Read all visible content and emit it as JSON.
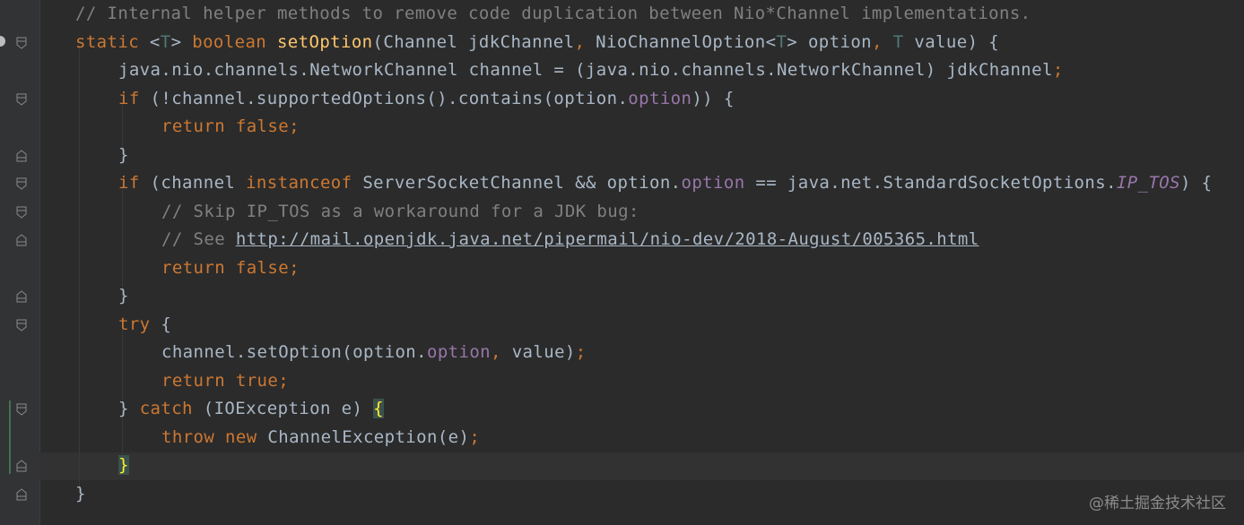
{
  "editor": {
    "colors": {
      "background": "#2b2b2b",
      "gutter": "#313335",
      "comment": "#808080",
      "keyword": "#cc7832",
      "method": "#ffc66d",
      "field": "#9876aa",
      "type_param": "#507874",
      "text": "#a9b7c6"
    },
    "lines": [
      {
        "tokens": [
          {
            "t": "// Internal helper methods to remove code duplication between Nio*Channel implementations.",
            "c": "comment"
          }
        ]
      },
      {
        "tokens": [
          {
            "t": "static ",
            "c": "kw"
          },
          {
            "t": "<",
            "c": "plain"
          },
          {
            "t": "T",
            "c": "type"
          },
          {
            "t": "> ",
            "c": "plain"
          },
          {
            "t": "boolean ",
            "c": "kw"
          },
          {
            "t": "setOption",
            "c": "fn"
          },
          {
            "t": "(Channel jdkChannel",
            "c": "plain"
          },
          {
            "t": ", ",
            "c": "semi"
          },
          {
            "t": "NioChannelOption<",
            "c": "plain"
          },
          {
            "t": "T",
            "c": "type"
          },
          {
            "t": "> option",
            "c": "plain"
          },
          {
            "t": ", ",
            "c": "semi"
          },
          {
            "t": "T ",
            "c": "type"
          },
          {
            "t": "value) {",
            "c": "plain"
          }
        ]
      },
      {
        "tokens": [
          {
            "t": "java.nio.channels.NetworkChannel channel = (java.nio.channels.NetworkChannel) jdkChannel",
            "c": "plain"
          },
          {
            "t": ";",
            "c": "semi"
          }
        ]
      },
      {
        "tokens": [
          {
            "t": "if ",
            "c": "kw"
          },
          {
            "t": "(!channel.supportedOptions().contains(option.",
            "c": "plain"
          },
          {
            "t": "option",
            "c": "field"
          },
          {
            "t": ")) {",
            "c": "plain"
          }
        ]
      },
      {
        "tokens": [
          {
            "t": "return false",
            "c": "kw"
          },
          {
            "t": ";",
            "c": "semi"
          }
        ]
      },
      {
        "tokens": [
          {
            "t": "}",
            "c": "plain"
          }
        ]
      },
      {
        "tokens": [
          {
            "t": "if ",
            "c": "kw"
          },
          {
            "t": "(channel ",
            "c": "plain"
          },
          {
            "t": "instanceof ",
            "c": "kw"
          },
          {
            "t": "ServerSocketChannel && option.",
            "c": "plain"
          },
          {
            "t": "option",
            "c": "field"
          },
          {
            "t": " == java.net.StandardSocketOptions.",
            "c": "plain"
          },
          {
            "t": "IP_TOS",
            "c": "static"
          },
          {
            "t": ") {",
            "c": "plain"
          }
        ]
      },
      {
        "tokens": [
          {
            "t": "// Skip IP_TOS as a workaround for a JDK bug:",
            "c": "comment"
          }
        ]
      },
      {
        "tokens": [
          {
            "t": "// See ",
            "c": "comment"
          },
          {
            "t": "http://mail.openjdk.java.net/pipermail/nio-dev/2018-August/005365.html",
            "c": "link"
          }
        ]
      },
      {
        "tokens": [
          {
            "t": "return false",
            "c": "kw"
          },
          {
            "t": ";",
            "c": "semi"
          }
        ]
      },
      {
        "tokens": [
          {
            "t": "}",
            "c": "plain"
          }
        ]
      },
      {
        "tokens": [
          {
            "t": "try ",
            "c": "kw"
          },
          {
            "t": "{",
            "c": "plain"
          }
        ]
      },
      {
        "tokens": [
          {
            "t": "channel.setOption(option.",
            "c": "plain"
          },
          {
            "t": "option",
            "c": "field"
          },
          {
            "t": ", ",
            "c": "semi"
          },
          {
            "t": "value)",
            "c": "plain"
          },
          {
            "t": ";",
            "c": "semi"
          }
        ]
      },
      {
        "tokens": [
          {
            "t": "return true",
            "c": "kw"
          },
          {
            "t": ";",
            "c": "semi"
          }
        ]
      },
      {
        "tokens": [
          {
            "t": "} ",
            "c": "plain"
          },
          {
            "t": "catch ",
            "c": "kw"
          },
          {
            "t": "(IOException e) ",
            "c": "plain"
          },
          {
            "t": "{",
            "c": "brace-hl"
          }
        ]
      },
      {
        "tokens": [
          {
            "t": "throw new ",
            "c": "kw"
          },
          {
            "t": "ChannelException(e)",
            "c": "plain"
          },
          {
            "t": ";",
            "c": "semi"
          }
        ]
      },
      {
        "tokens": [
          {
            "t": "}",
            "c": "brace-hl"
          }
        ]
      },
      {
        "tokens": [
          {
            "t": "}",
            "c": "plain"
          }
        ]
      }
    ]
  },
  "watermark": "@稀土掘金技术社区"
}
